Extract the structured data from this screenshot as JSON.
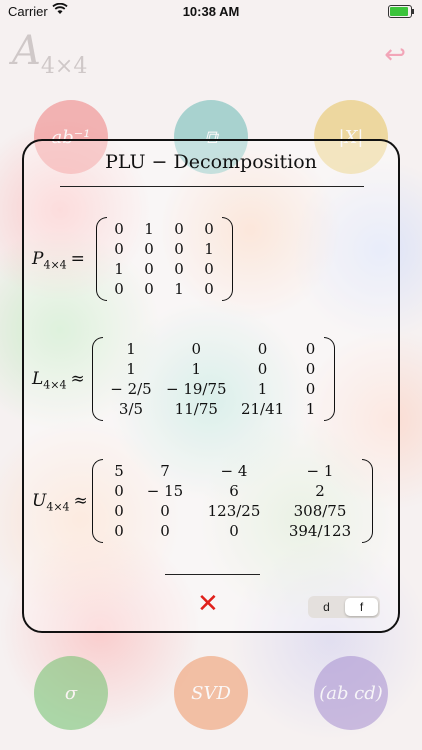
{
  "status_bar": {
    "carrier": "Carrier",
    "time": "10:38 AM",
    "battery_level": 0.9
  },
  "header": {
    "matrix_symbol": "A",
    "matrix_size": "4×4",
    "back_icon": "undo-arrow-icon"
  },
  "background_buttons": [
    {
      "name": "inverse-button",
      "label": "ab⁻¹",
      "color": "#f07f7f"
    },
    {
      "name": "transpose-button",
      "label": "⧉",
      "color": "#69b9b5"
    },
    {
      "name": "determinant-button",
      "label": "|X|",
      "color": "#e6c35d"
    },
    {
      "name": "qr-button",
      "label": "σ",
      "color": "#6fc16c"
    },
    {
      "name": "svd-button",
      "label": "SVD",
      "color": "#f09766"
    },
    {
      "name": "matrix-add-button",
      "label": "(ab cd)",
      "color": "#a68ed0"
    }
  ],
  "dialog": {
    "title": "PLU − Decomposition",
    "matrices": [
      {
        "symbol": "P",
        "size": "4×4",
        "relation": "=",
        "rows": [
          [
            "0",
            "1",
            "0",
            "0"
          ],
          [
            "0",
            "0",
            "0",
            "1"
          ],
          [
            "1",
            "0",
            "0",
            "0"
          ],
          [
            "0",
            "0",
            "1",
            "0"
          ]
        ]
      },
      {
        "symbol": "L",
        "size": "4×4",
        "relation": "≈",
        "rows": [
          [
            "1",
            "0",
            "0",
            "0"
          ],
          [
            "1",
            "1",
            "0",
            "0"
          ],
          [
            "− 2/5",
            "− 19/75",
            "1",
            "0"
          ],
          [
            "3/5",
            "11/75",
            "21/41",
            "1"
          ]
        ]
      },
      {
        "symbol": "U",
        "size": "4×4",
        "relation": "≈",
        "rows": [
          [
            "5",
            "7",
            "− 4",
            "− 1"
          ],
          [
            "0",
            "− 15",
            "6",
            "2"
          ],
          [
            "0",
            "0",
            "123/25",
            "308/75"
          ],
          [
            "0",
            "0",
            "0",
            "394/123"
          ]
        ]
      }
    ],
    "close_icon": "close-x-icon",
    "format_options": [
      "d",
      "f"
    ],
    "format_selected": "f"
  }
}
